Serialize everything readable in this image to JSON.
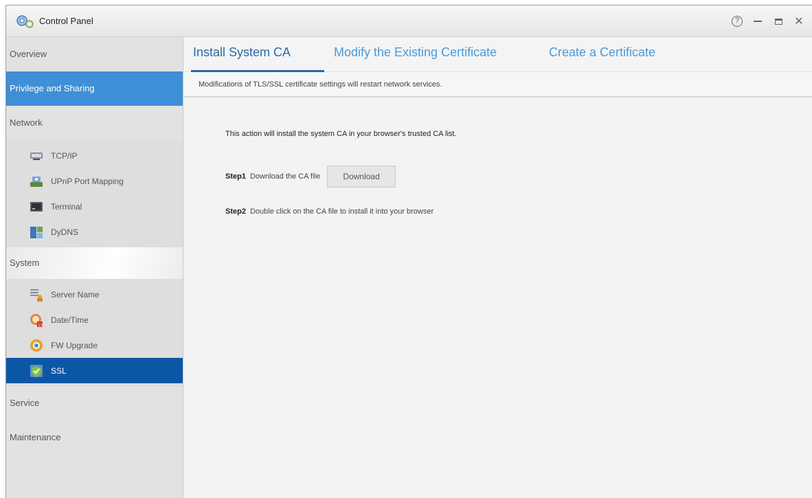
{
  "window": {
    "title": "Control Panel",
    "controls": {
      "help": "?",
      "close": "✕"
    }
  },
  "sidebar": {
    "categories": {
      "overview": "Overview",
      "privilege": "Privilege and Sharing",
      "network": "Network",
      "system": "System",
      "service": "Service",
      "maintenance": "Maintenance"
    },
    "network_items": [
      {
        "label": "TCP/IP",
        "icon": "network-card-icon"
      },
      {
        "label": "UPnP Port Mapping",
        "icon": "upnp-icon"
      },
      {
        "label": "Terminal",
        "icon": "terminal-icon"
      },
      {
        "label": "DyDNS",
        "icon": "dydns-icon"
      }
    ],
    "system_items": [
      {
        "label": "Server Name",
        "icon": "server-name-icon"
      },
      {
        "label": "Date/Time",
        "icon": "date-time-icon"
      },
      {
        "label": "FW Upgrade",
        "icon": "fw-upgrade-icon"
      },
      {
        "label": "SSL",
        "icon": "ssl-shield-icon"
      }
    ]
  },
  "tabs": [
    {
      "label": "Install System CA"
    },
    {
      "label": "Modify the Existing Certificate"
    },
    {
      "label": "Create a Certificate"
    }
  ],
  "notice": "Modifications of TLS/SSL certificate settings will restart network services.",
  "content": {
    "description": "This action will install the system CA in your browser's trusted CA list.",
    "step1": {
      "label": "Step1",
      "text": "Download the CA file",
      "button": "Download"
    },
    "step2": {
      "label": "Step2",
      "text": "Double click on the CA file to install it into your browser"
    }
  },
  "colors": {
    "selected_category": "#3d8fd6",
    "selected_item": "#0b57a6",
    "tab_text": "#4a9ad8",
    "tab_underline": "#2a6ab0"
  }
}
